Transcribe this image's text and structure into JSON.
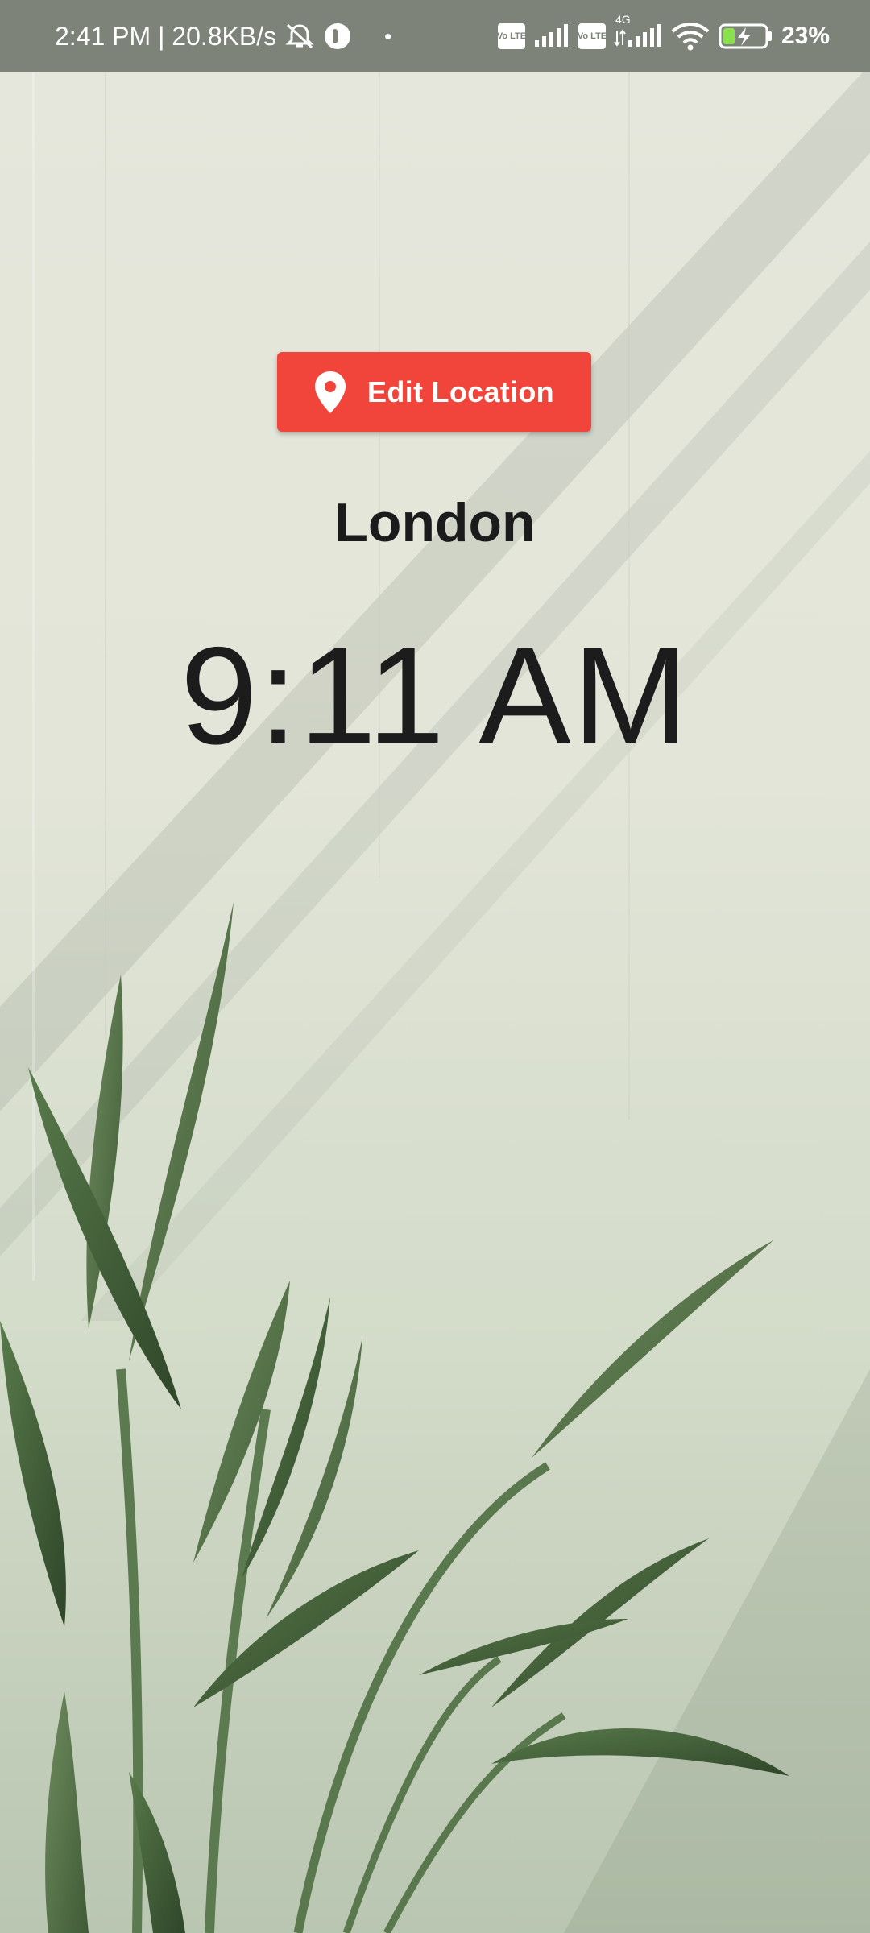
{
  "status_bar": {
    "time_speed": "2:41 PM | 20.8KB/s",
    "dot": "•",
    "volte_label_1": "Vo LTE",
    "volte_label_2": "Vo LTE",
    "network_type": "4G",
    "battery_percent": "23%",
    "icons": [
      "mute-icon",
      "app-notification-icon",
      "signal-icon",
      "wifi-icon",
      "battery-charging-icon"
    ]
  },
  "main": {
    "edit_location_label": "Edit Location",
    "edit_location_icon": "location-pin-icon",
    "location_name": "London",
    "local_time": "9:11 AM"
  },
  "colors": {
    "button": "#f1453b",
    "status_bar": "#7e8379",
    "text": "#1b1b1b"
  }
}
